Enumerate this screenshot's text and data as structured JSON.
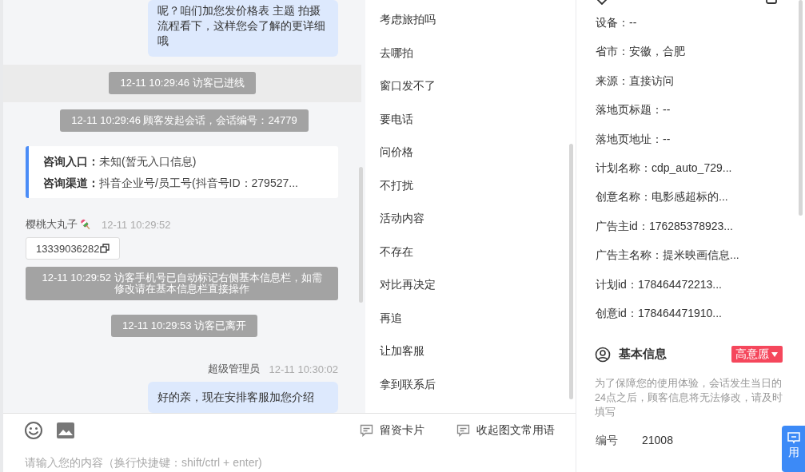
{
  "chat": {
    "messages": [
      {
        "kind": "bubble",
        "text": "呢？咱们加您发价格表 主题 拍摄流程看下，这样您会了解的更详细哦"
      },
      {
        "kind": "system",
        "highlighted": true,
        "text": "12-11 10:29:46 访客已进线"
      },
      {
        "kind": "system",
        "highlighted": false,
        "text": "12-11 10:29:46 顾客发起会话，会话编号：24779"
      },
      {
        "kind": "info_card",
        "rows": [
          {
            "label": "咨询入口：",
            "value": "未知(暂无入口信息)"
          },
          {
            "label": "咨询渠道：",
            "value": "抖音企业号/员工号(抖音号ID：279527..."
          }
        ]
      },
      {
        "kind": "visitor_sender",
        "name": "樱桃大丸子",
        "time": "12-11 10:29:52"
      },
      {
        "kind": "phone",
        "text": "13339036282"
      },
      {
        "kind": "system",
        "highlighted": false,
        "text": "12-11 10:29:52 访客手机号已自动标记右侧基本信息栏，如需修改请在基本信息栏直接操作"
      },
      {
        "kind": "system",
        "highlighted": false,
        "text": "12-11 10:29:53 访客已离开"
      },
      {
        "kind": "agent_sender",
        "name": "超级管理员",
        "time": "12-11 10:30:02"
      },
      {
        "kind": "bubble",
        "text": "好的亲，现在安排客服加您介绍"
      }
    ]
  },
  "composer": {
    "placeholder": "请输入您的内容（换行快捷键：shift/ctrl + enter)"
  },
  "quick_replies": {
    "items": [
      "考虑旅拍吗",
      "去哪拍",
      "窗口发不了",
      "要电话",
      "问价格",
      "不打扰",
      "活动内容",
      "不存在",
      "对比再决定",
      "再追",
      "让加客服",
      "拿到联系后"
    ],
    "actions": [
      "留资卡片",
      "收起图文常用语"
    ]
  },
  "source_info": {
    "fields": [
      "设备：--",
      "省市：安徽，合肥",
      "来源：直接访问",
      "落地页标题：--",
      "落地页地址：--",
      "计划名称：cdp_auto_729...",
      "创意名称：电影感超标的...",
      "广告主id：176285378923...",
      "广告主名称：提米映画信息...",
      "计划id：178464472213...",
      "创意id：178464471910..."
    ]
  },
  "basic_info": {
    "title": "基本信息",
    "tag": "高意愿",
    "note": "为了保障您的使用体验，会话发生当日的24点之后，顾客信息将无法修改，请及时填写",
    "fields": [
      {
        "label": "编号",
        "value": "21008"
      }
    ]
  },
  "side_tab": {
    "label": "用"
  }
}
